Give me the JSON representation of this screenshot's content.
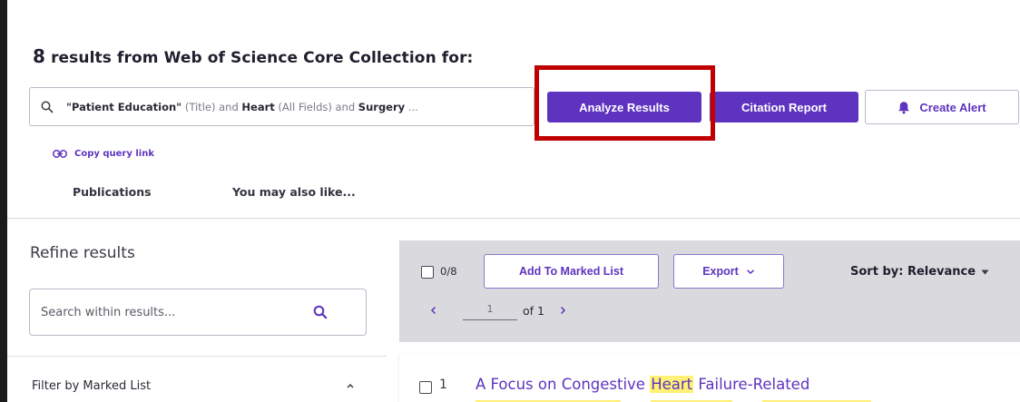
{
  "headline": {
    "count": "8",
    "text": "results from Web of Science Core Collection for:"
  },
  "query": {
    "part1_value": "\"Patient Education\"",
    "part1_field": "(Title) and",
    "part2_value": "Heart",
    "part2_field": "(All Fields) and",
    "part3_value": "Surgery",
    "ellipsis": "..."
  },
  "actions": {
    "analyze_label": "Analyze Results",
    "citation_label": "Citation Report",
    "alert_label": "Create Alert"
  },
  "copy_link_label": "Copy query link",
  "tabs": [
    {
      "label": "Publications"
    },
    {
      "label": "You may also like..."
    }
  ],
  "refine": {
    "title": "Refine results",
    "search_placeholder": "Search within results...",
    "filter_marked_label": "Filter by Marked List"
  },
  "toolbar": {
    "selected_count": "0/8",
    "add_marked_label": "Add To Marked List",
    "export_label": "Export",
    "sort_label": "Sort by: Relevance",
    "page_value": "1",
    "page_of": "of 1"
  },
  "results": [
    {
      "number": "1",
      "title_before": "A Focus on Congestive ",
      "title_highlight": "Heart",
      "title_after": " Failure-Related"
    }
  ],
  "colors": {
    "brand": "#5e33bf",
    "highlight_box": "#c00000",
    "toolbar_bg": "#d9d9de",
    "term_highlight": "#fff176"
  }
}
